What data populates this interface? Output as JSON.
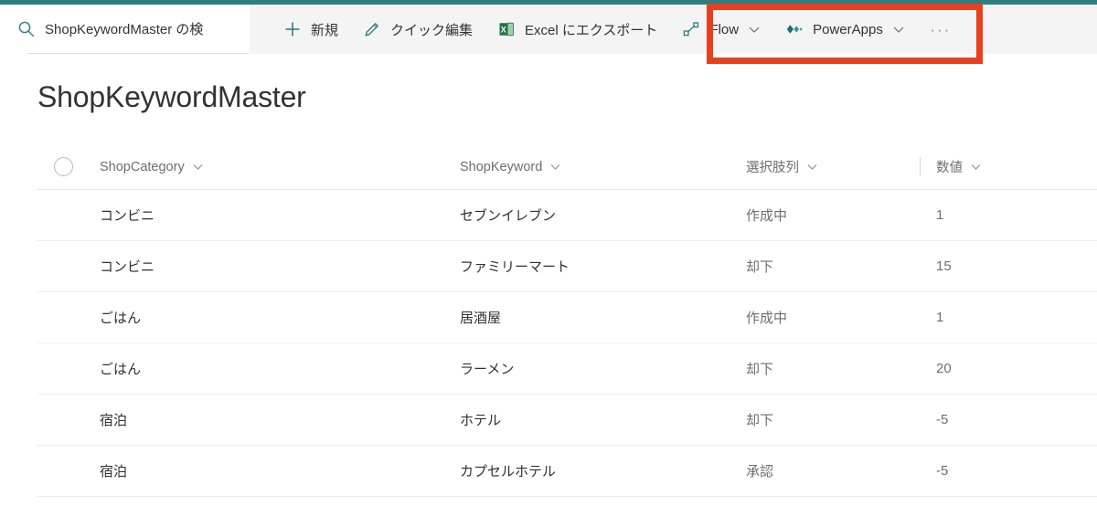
{
  "theme": {
    "accent_teal": "#2d7d81",
    "highlight_red": "#e8401f",
    "toolbar_bg": "#f4f4f4",
    "excel_green": "#217346"
  },
  "search": {
    "icon": "search-icon",
    "value": "ShopKeywordMaster の検",
    "placeholder": "ShopKeywordMaster の検索"
  },
  "toolbar": {
    "commands": [
      {
        "id": "new",
        "icon": "plus-icon",
        "label": "新規",
        "has_chevron": false
      },
      {
        "id": "quick-edit",
        "icon": "pencil-icon",
        "label": "クイック編集",
        "has_chevron": false
      },
      {
        "id": "export-excel",
        "icon": "excel-icon",
        "label": "Excel にエクスポート",
        "has_chevron": false
      },
      {
        "id": "flow",
        "icon": "flow-icon",
        "label": "Flow",
        "has_chevron": true
      },
      {
        "id": "powerapps",
        "icon": "powerapps-icon",
        "label": "PowerApps",
        "has_chevron": true
      }
    ],
    "overflow_label": "···"
  },
  "page": {
    "title": "ShopKeywordMaster"
  },
  "list": {
    "columns": [
      {
        "id": "select",
        "label": "",
        "has_chevron": false,
        "divider_before": false
      },
      {
        "id": "shopcategory",
        "label": "ShopCategory",
        "has_chevron": true,
        "divider_before": false
      },
      {
        "id": "shopkeyword",
        "label": "ShopKeyword",
        "has_chevron": true,
        "divider_before": false
      },
      {
        "id": "choice",
        "label": "選択肢列",
        "has_chevron": true,
        "divider_before": false
      },
      {
        "id": "number",
        "label": "数値",
        "has_chevron": true,
        "divider_before": true
      }
    ],
    "rows": [
      {
        "shopcategory": "コンビニ",
        "shopkeyword": "セブンイレブン",
        "choice": "作成中",
        "number": "1"
      },
      {
        "shopcategory": "コンビニ",
        "shopkeyword": "ファミリーマート",
        "choice": "却下",
        "number": "15"
      },
      {
        "shopcategory": "ごはん",
        "shopkeyword": "居酒屋",
        "choice": "作成中",
        "number": "1"
      },
      {
        "shopcategory": "ごはん",
        "shopkeyword": "ラーメン",
        "choice": "却下",
        "number": "20"
      },
      {
        "shopcategory": "宿泊",
        "shopkeyword": "ホテル",
        "choice": "却下",
        "number": "-5"
      },
      {
        "shopcategory": "宿泊",
        "shopkeyword": "カプセルホテル",
        "choice": "承認",
        "number": "-5"
      }
    ]
  },
  "annotation": {
    "highlight_target": "Flow / PowerApps commands"
  }
}
